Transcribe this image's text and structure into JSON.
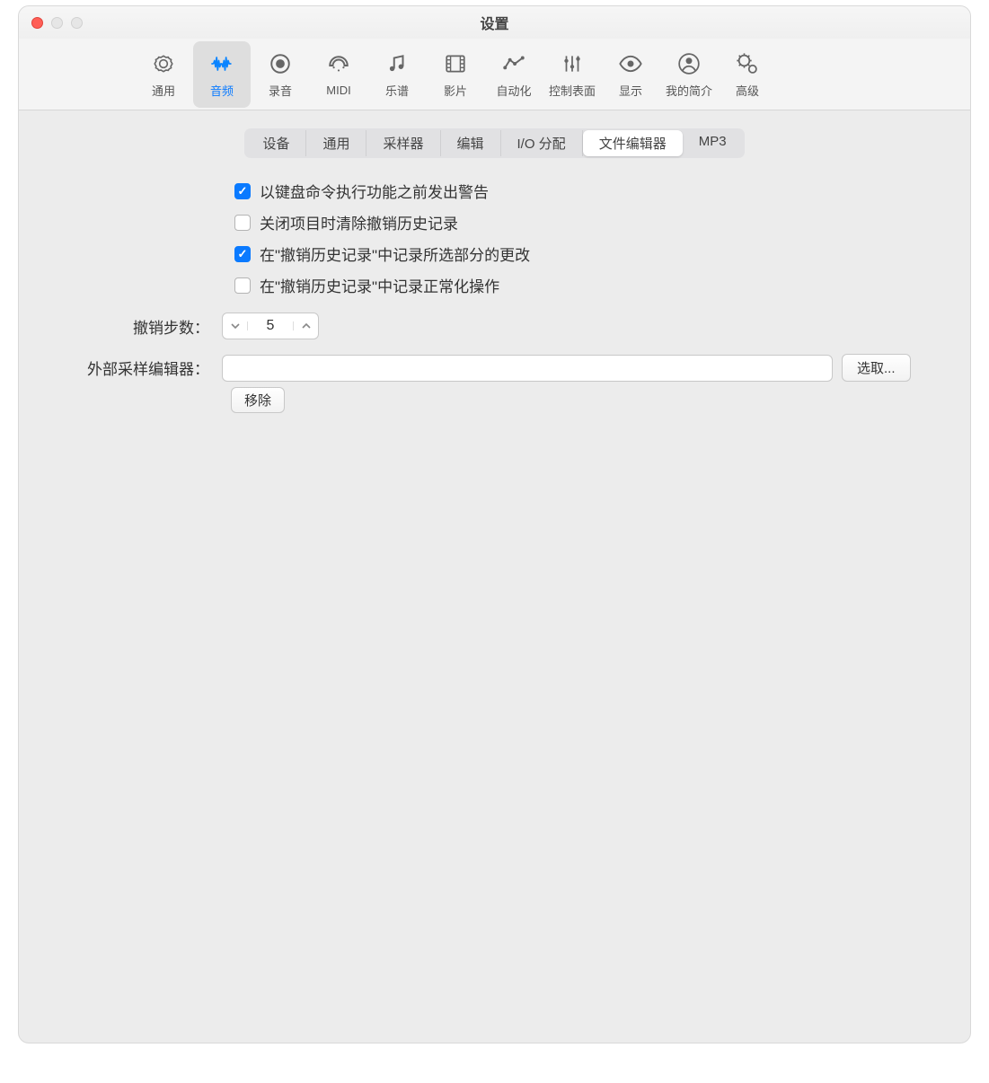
{
  "window": {
    "title": "设置"
  },
  "toolbar": {
    "items": [
      {
        "label": "通用"
      },
      {
        "label": "音频"
      },
      {
        "label": "录音"
      },
      {
        "label": "MIDI"
      },
      {
        "label": "乐谱"
      },
      {
        "label": "影片"
      },
      {
        "label": "自动化"
      },
      {
        "label": "控制表面"
      },
      {
        "label": "显示"
      },
      {
        "label": "我的简介"
      },
      {
        "label": "高级"
      }
    ],
    "activeIndex": 1
  },
  "tabs": {
    "items": [
      "设备",
      "通用",
      "采样器",
      "编辑",
      "I/O 分配",
      "文件编辑器",
      "MP3"
    ],
    "activeIndex": 5
  },
  "checks": [
    {
      "label": "以键盘命令执行功能之前发出警告",
      "checked": true
    },
    {
      "label": "关闭项目时清除撤销历史记录",
      "checked": false
    },
    {
      "label": "在\"撤销历史记录\"中记录所选部分的更改",
      "checked": true
    },
    {
      "label": "在\"撤销历史记录\"中记录正常化操作",
      "checked": false
    }
  ],
  "undo": {
    "label": "撤销步数：",
    "value": "5"
  },
  "external": {
    "label": "外部采样编辑器：",
    "choose": "选取...",
    "remove": "移除",
    "value": ""
  }
}
